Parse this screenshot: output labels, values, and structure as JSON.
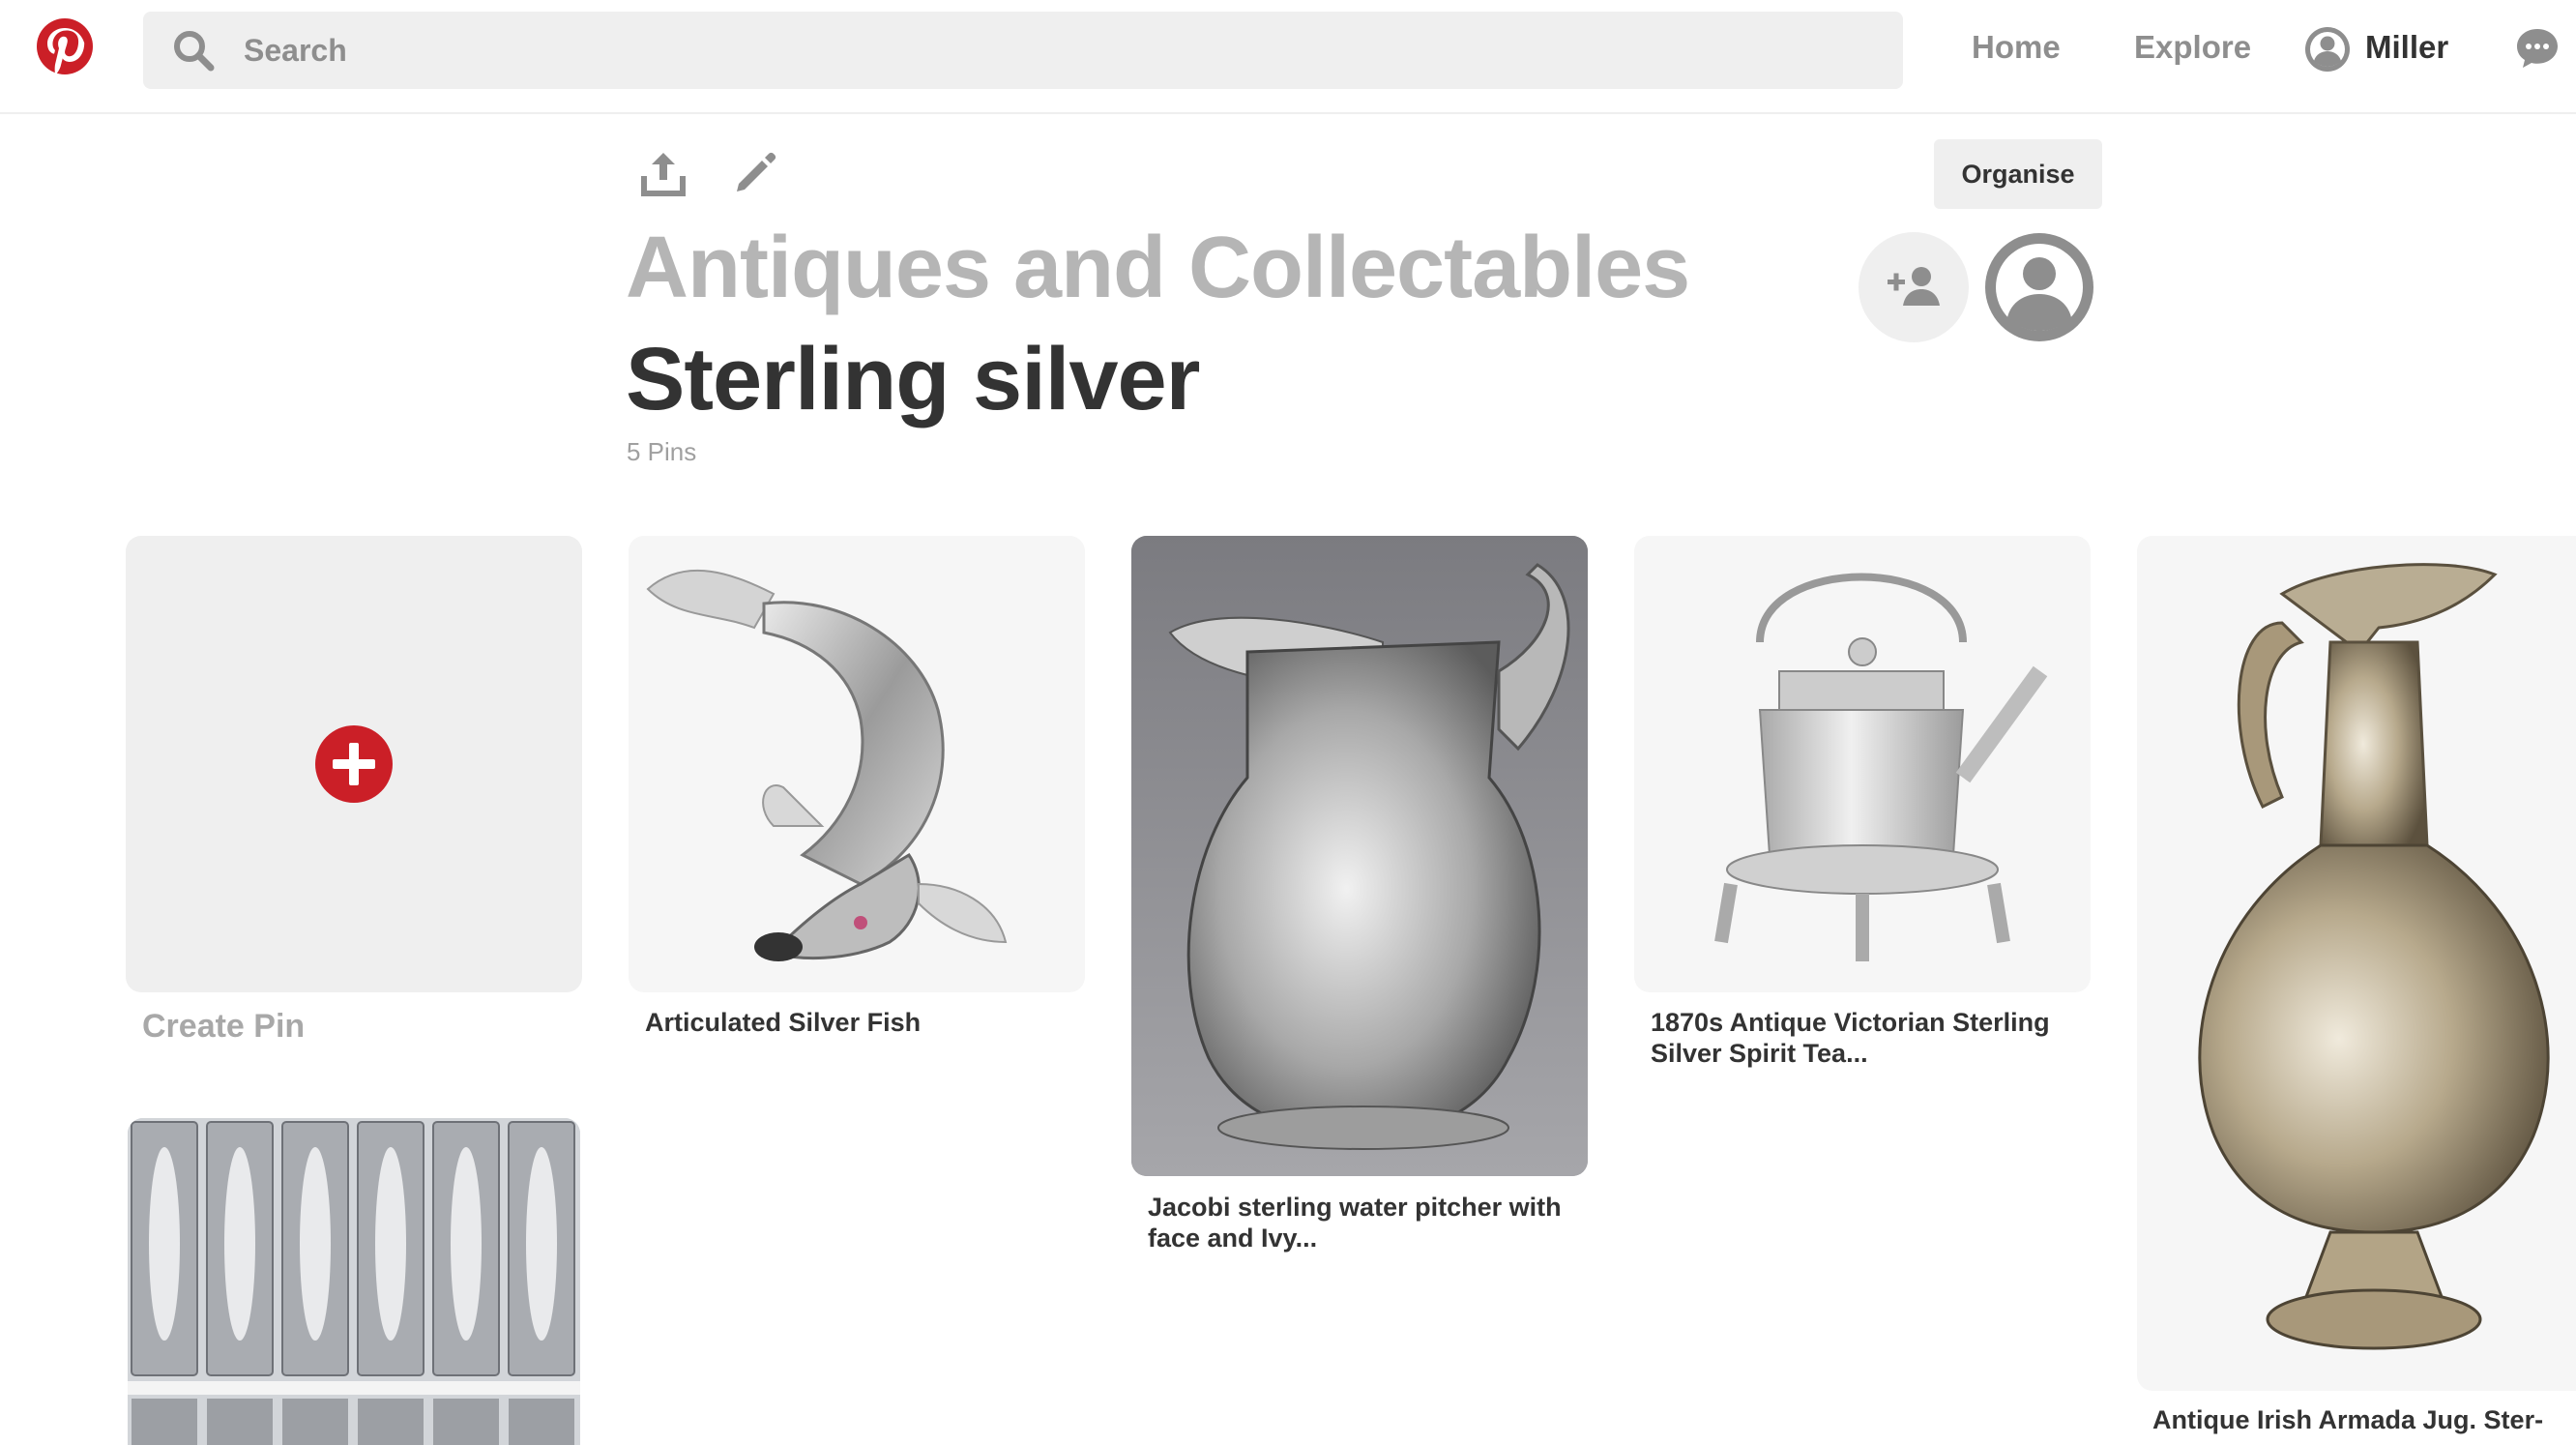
{
  "header": {
    "logo_icon": "pinterest-logo-icon",
    "search": {
      "icon": "search-icon",
      "placeholder": "Search"
    },
    "nav": {
      "home": "Home",
      "explore": "Explore"
    },
    "user": {
      "name": "Miller",
      "avatar_icon": "user-avatar-icon"
    },
    "chat_icon": "chat-bubble-icon"
  },
  "board": {
    "tools": {
      "share_icon": "share-upload-icon",
      "edit_icon": "pencil-edit-icon"
    },
    "organise_label": "Organise",
    "parent_title": "Antiques and Collectables",
    "title": "Sterling silver",
    "pin_count": "5 Pins",
    "collaborators": {
      "add_icon": "add-person-icon",
      "owner_icon": "user-avatar-icon"
    }
  },
  "grid": {
    "create": {
      "label": "Create Pin",
      "icon": "plus-circle-icon"
    },
    "pins": [
      {
        "caption": "Articulated Silver Fish",
        "subject": "silver fish"
      },
      {
        "caption": "Jacobi sterling water pitcher with face and Ivy...",
        "subject": "silver pitcher"
      },
      {
        "caption": "1870s Antique Victorian Sterling Silver Spirit Tea...",
        "subject": "silver kettle"
      },
      {
        "caption": "Antique Irish Armada Jug. Ster-",
        "subject": "silver ewer"
      },
      {
        "caption": "",
        "subject": "silver spoon handles"
      }
    ]
  },
  "colors": {
    "brand_red": "#cb1f27",
    "text_dark": "#333333",
    "text_gray": "#8e8e8e",
    "title_gray": "#b5b5b5",
    "tile_bg": "#efefef"
  }
}
